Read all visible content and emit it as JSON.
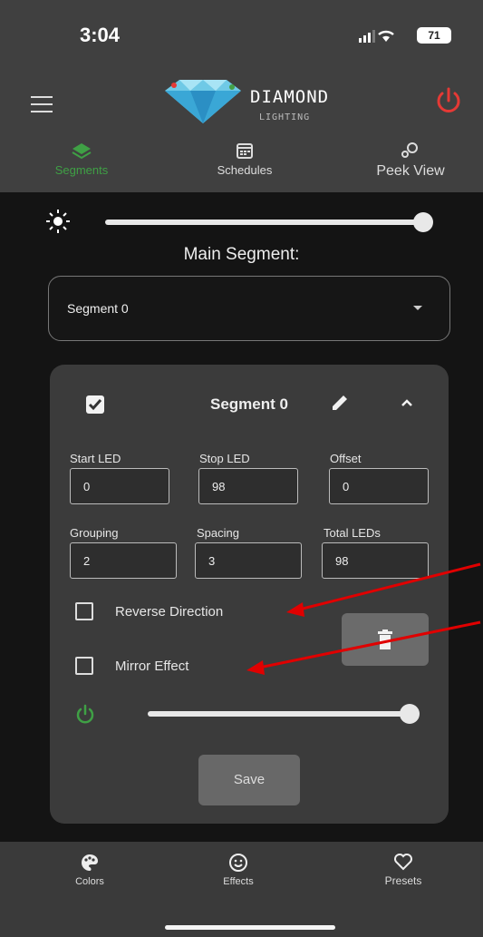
{
  "status_bar": {
    "time": "3:04",
    "battery": "71"
  },
  "header": {
    "logo_text": "DIAMOND",
    "logo_sub": "LIGHTING"
  },
  "top_tabs": [
    {
      "label": "Segments",
      "icon": "layers-icon"
    },
    {
      "label": "Schedules",
      "icon": "calendar-icon"
    },
    {
      "label": "Peek View",
      "icon": "bubbles-icon"
    }
  ],
  "brightness": {
    "level": 1.0
  },
  "main_segment": {
    "label": "Main Segment:",
    "selected": "Segment 0"
  },
  "segment_card": {
    "title": "Segment 0",
    "checked": true,
    "fields": [
      {
        "label": "Start LED",
        "value": "0"
      },
      {
        "label": "Stop LED",
        "value": "98"
      },
      {
        "label": "Offset",
        "value": "0"
      },
      {
        "label": "Grouping",
        "value": "2"
      },
      {
        "label": "Spacing",
        "value": "3"
      },
      {
        "label": "Total LEDs",
        "value": "98"
      }
    ],
    "reverse_direction": "Reverse Direction",
    "mirror_effect": "Mirror Effect",
    "segment_brightness": 1.0,
    "save_label": "Save"
  },
  "bottom_nav": [
    {
      "label": "Colors",
      "icon": "palette-icon"
    },
    {
      "label": "Effects",
      "icon": "smiley-icon"
    },
    {
      "label": "Presets",
      "icon": "heart-icon"
    }
  ],
  "colors": {
    "accent_green": "#3fa045",
    "power_red": "#e53935",
    "annotation_red": "#e00000"
  }
}
